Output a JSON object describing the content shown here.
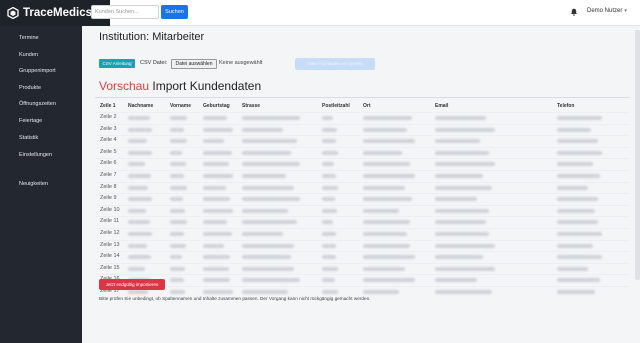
{
  "app": {
    "name": "TraceMedics"
  },
  "topbar": {
    "search_placeholder": "Kunden Suchen...",
    "search_button": "Suchen",
    "user_name": "Demo Nutzer",
    "user_caret": "▾"
  },
  "sidebar": {
    "items": [
      {
        "label": "Termine"
      },
      {
        "label": "Kunden"
      },
      {
        "label": "Gruppenimport"
      },
      {
        "label": "Produkte"
      },
      {
        "label": "Öffnungszeiten"
      },
      {
        "label": "Feiertage"
      },
      {
        "label": "Statistik"
      },
      {
        "label": "Einstellungen"
      },
      {
        "label": "Neuigkeiten"
      }
    ]
  },
  "page": {
    "title": "Institution: Mitarbeiter",
    "csv_button": "CSV Anleitung",
    "csv_label": "CSV Datei:",
    "file_button": "Datei auswählen",
    "file_status": "Keine ausgewählt",
    "upload_button": "Datei hochladen und prüfen",
    "preview_red": "Vorschau",
    "preview_rest": " Import Kundendaten"
  },
  "table": {
    "headers": [
      "Zeile 1",
      "Nachname",
      "Vorname",
      "Geburtstag",
      "Strasse",
      "Postleitzahl",
      "Ort",
      "Email",
      "Telefon"
    ],
    "rows": [
      "Zeile 2",
      "Zeile 3",
      "Zeile 4",
      "Zeile 5",
      "Zeile 6",
      "Zeile 7",
      "Zeile 8",
      "Zeile 9",
      "Zeile 10",
      "Zeile 11",
      "Zeile 12",
      "Zeile 13",
      "Zeile 14",
      "Zeile 15",
      "Zeile 16",
      "Zeile 17"
    ]
  },
  "footer": {
    "import_button": "Jetzt endgültig importieren",
    "hint": "Bitte prüfen Sie unbedingt, ob Spaltennamen und Inhalte zusammen passen. Der Vorgang kann nicht rückgängig gemacht werden."
  },
  "colors": {
    "accent": "#1a73e8",
    "info": "#17a2b8",
    "danger": "#dc3545",
    "sidebar_bg": "#23272f"
  }
}
